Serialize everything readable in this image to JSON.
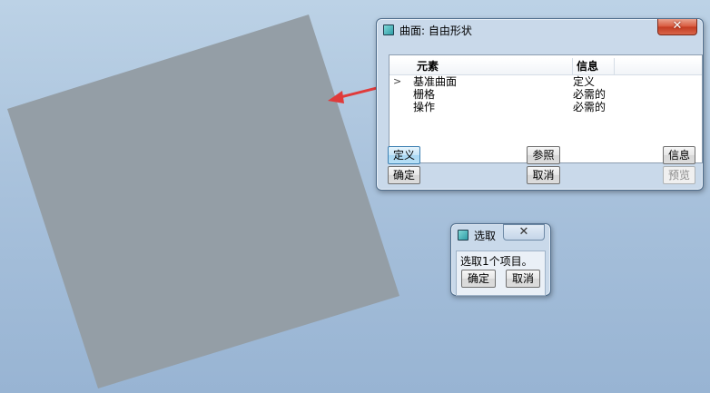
{
  "surface": {
    "fill": "#949ea6"
  },
  "annotation": {
    "arrow_color": "#e03b3b"
  },
  "main_dialog": {
    "title": "曲面: 自由形状",
    "close_label": "✕",
    "columns": [
      "元素",
      "信息"
    ],
    "rows": [
      {
        "element": "基准曲面",
        "info": "定义",
        "current": true
      },
      {
        "element": "栅格",
        "info": "必需的",
        "current": false
      },
      {
        "element": "操作",
        "info": "必需的",
        "current": false
      }
    ],
    "buttons": {
      "define": "定义",
      "reference": "参照",
      "info": "信息",
      "ok": "确定",
      "cancel": "取消",
      "preview": "预览"
    }
  },
  "select_dialog": {
    "title": "选取",
    "close_label": "✕",
    "message": "选取1个项目。",
    "ok": "确定",
    "cancel": "取消"
  }
}
